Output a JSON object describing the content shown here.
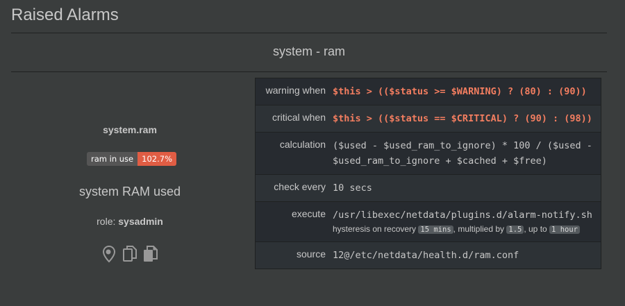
{
  "header": {
    "title": "Raised Alarms"
  },
  "alarm": {
    "heading": "system - ram",
    "chart": "system.ram",
    "badge": {
      "label": "ram in use",
      "value": "102.7%",
      "value_color": "#e05d44"
    },
    "info": "system RAM used",
    "role_label": "role:",
    "role_value": "sysadmin",
    "icons": [
      "map-marker-icon",
      "copy-icon",
      "paste-icon"
    ]
  },
  "details": {
    "warning_label": "warning when",
    "warning_value": "$this > (($status >= $WARNING) ? (80) : (90))",
    "critical_label": "critical when",
    "critical_value": "$this > (($status == $CRITICAL) ? (90) : (98))",
    "calc_label": "calculation",
    "calc_value": "($used - $used_ram_to_ignore) * 100 / ($used - $used_ram_to_ignore + $cached + $free)",
    "every_label": "check every",
    "every_value": "10 secs",
    "exec_label": "execute",
    "exec_value": "/usr/libexec/netdata/plugins.d/alarm-notify.sh",
    "hyst_prefix": "hysteresis on recovery",
    "hyst_delay": "15 mins",
    "hyst_mult_text": ", multiplied by",
    "hyst_mult": "1.5",
    "hyst_upto_text": ", up to",
    "hyst_max": "1 hour",
    "source_label": "source",
    "source_value": "12@/etc/netdata/health.d/ram.conf"
  }
}
